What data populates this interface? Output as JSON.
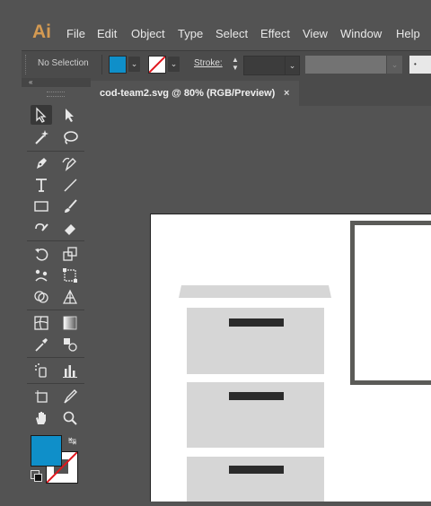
{
  "app": {
    "logo": "Ai"
  },
  "menu": [
    {
      "key": "file",
      "label": "File"
    },
    {
      "key": "edit",
      "label": "Edit"
    },
    {
      "key": "object",
      "label": "Object"
    },
    {
      "key": "type",
      "label": "Type"
    },
    {
      "key": "select",
      "label": "Select"
    },
    {
      "key": "effect",
      "label": "Effect"
    },
    {
      "key": "view",
      "label": "View"
    },
    {
      "key": "window",
      "label": "Window"
    },
    {
      "key": "help",
      "label": "Help"
    }
  ],
  "control": {
    "selection_status": "No Selection",
    "stroke_label": "Stroke:",
    "stroke_width": "",
    "fill_color": "#0f8fc9",
    "brush_dot": "•"
  },
  "toolbar": {
    "collapse_glyph": "«",
    "fill_color": "#0f8fc9",
    "stroke_color": "#ffffff",
    "tools": [
      "selection-tool",
      "direct-selection-tool",
      "magic-wand-tool",
      "lasso-tool",
      "pen-tool",
      "curvature-tool",
      "type-tool",
      "line-segment-tool",
      "rectangle-tool",
      "paintbrush-tool",
      "shaper-tool",
      "eraser-tool",
      "rotate-tool",
      "scale-tool",
      "puppet-warp-tool",
      "free-transform-tool",
      "shape-builder-tool",
      "perspective-grid-tool",
      "mesh-tool",
      "gradient-tool",
      "eyedropper-tool",
      "blend-tool",
      "symbol-sprayer-tool",
      "column-graph-tool",
      "artboard-tool",
      "slice-tool",
      "hand-tool",
      "zoom-tool"
    ]
  },
  "document": {
    "tab_title": "cod-team2.svg @ 80% (RGB/Preview)",
    "close_glyph": "×"
  },
  "artwork": {
    "cabinet_color": "#d6d6d6",
    "handle_color": "#2b2b2b",
    "frame_color": "#5b5b58"
  }
}
